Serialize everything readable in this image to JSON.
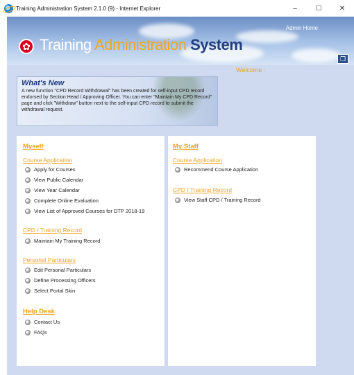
{
  "window": {
    "title": "Training Administration System 2.1.0  (9) - Internet Explorer",
    "minimize": "–",
    "maximize": "☐",
    "close": "✕"
  },
  "banner": {
    "brand_part1": "Training ",
    "brand_part2": "Administration",
    "brand_part3": " System",
    "admin_home": "Admin Home",
    "corner_icon": "book-icon"
  },
  "welcome": "Welcome :",
  "whats_new": {
    "title": "What's New",
    "body": "A new function \"CPD Record Withdrawal\" has been created for self-input CPD record endorsed by Section Head / Approving Officer. You can enter \"Maintain My CPD Record\" page and click \"Withdraw\" button next to the self-input CPD record to submit the withdrawal request."
  },
  "myself": {
    "title": "Myself",
    "course_application": {
      "title": "Course Application",
      "items": [
        "Apply for Courses",
        "View Public Calendar",
        "View Year Calendar",
        "Complete Online Evaluation",
        "View List of Approved Courses for DTP 2018-19"
      ]
    },
    "cpd": {
      "title": "CPD / Training Record",
      "items": [
        "Maintain My Training Record"
      ]
    },
    "personal": {
      "title": "Personal Particulars",
      "items": [
        "Edit Personal Particulars",
        "Define Processing Officers",
        "Select Portal Skin"
      ]
    },
    "help": {
      "title": "Help Desk",
      "items": [
        "Contact Us",
        "FAQs"
      ]
    }
  },
  "my_staff": {
    "title": "My Staff",
    "course_application": {
      "title": "Course Application",
      "items": [
        "Recommend Course Application"
      ]
    },
    "cpd": {
      "title": "CPD / Training Record",
      "items": [
        "View Staff CPD / Training Record"
      ]
    }
  }
}
